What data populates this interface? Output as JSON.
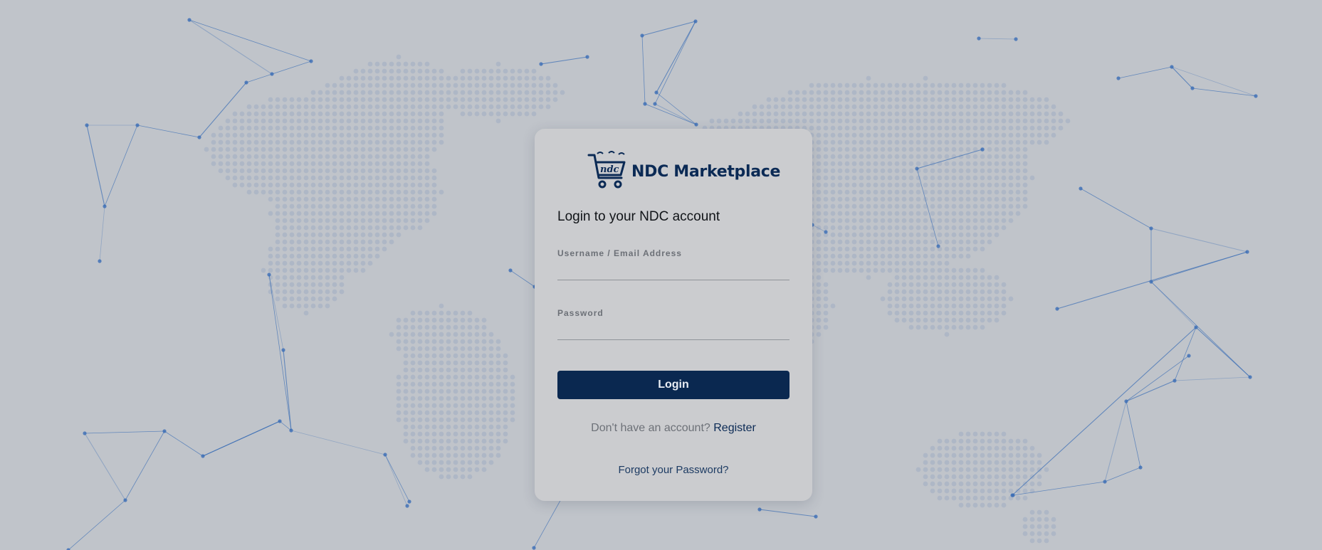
{
  "brand": {
    "logo_text": "ndc",
    "name": "NDC Marketplace",
    "logo_icon": "shopping-cart-icon"
  },
  "form": {
    "heading": "Login to your NDC account",
    "username_label": "Username / Email Address",
    "username_value": "",
    "password_label": "Password",
    "password_value": "",
    "login_label": "Login",
    "register_prompt": "Don't have an account?",
    "register_link": "Register",
    "forgot_link": "Forgot your Password?"
  },
  "colors": {
    "background": "#c0c4ca",
    "card": "#cbcccf",
    "primary": "#0a2850",
    "network_lines": "#3a6db5"
  }
}
